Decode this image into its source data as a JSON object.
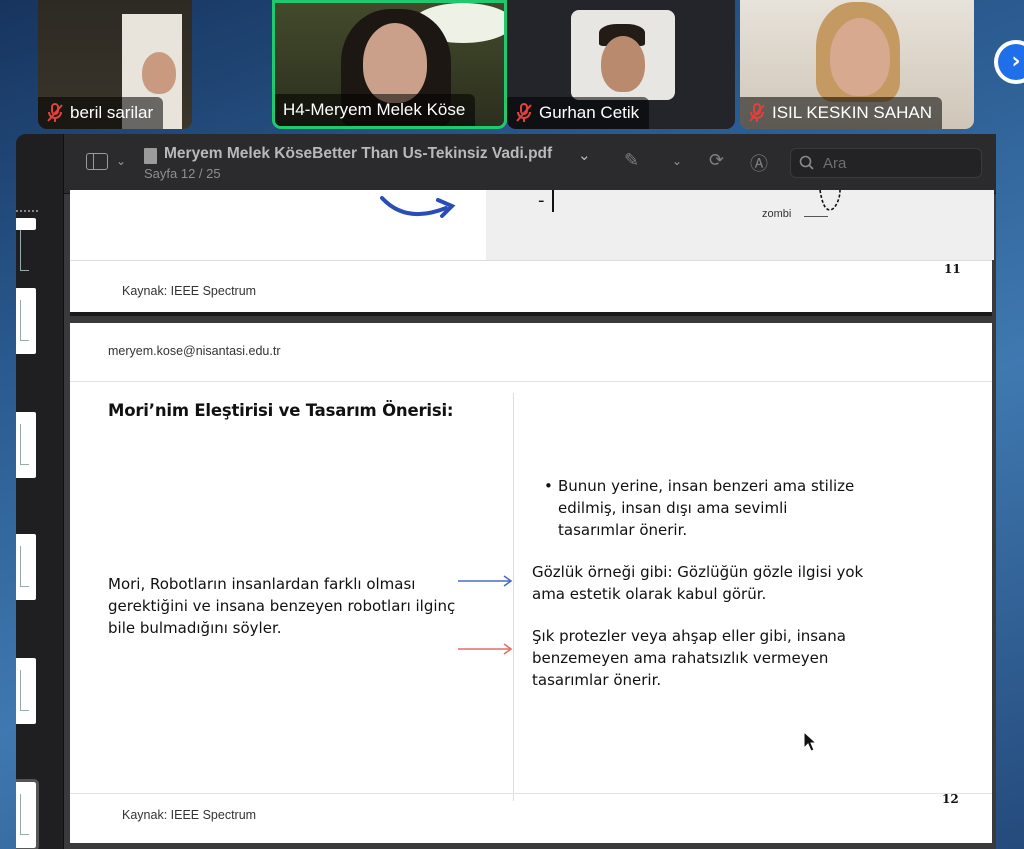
{
  "participants": [
    {
      "name": "beril sarilar",
      "muted": true
    },
    {
      "name": "H4-Meryem Melek Köse",
      "muted": false,
      "active": true
    },
    {
      "name": "Gurhan Cetik",
      "muted": true
    },
    {
      "name": "ISIL KESKIN SAHAN",
      "muted": true
    }
  ],
  "pdf": {
    "title": "Meryem Melek KöseBetter Than Us-Tekinsiz Vadi.pdf",
    "page_indicator": "Sayfa 12 / 25",
    "search_placeholder": "Ara"
  },
  "slide11": {
    "source": "Kaynak: IEEE Spectrum",
    "page_number": "11",
    "graph_label": "zombi",
    "minus_label": "-"
  },
  "slide12": {
    "email": "meryem.kose@nisantasi.edu.tr",
    "heading": "Mori’nim Eleştirisi ve Tasarım Önerisi:",
    "left_text": "Mori, Robotların insanlardan farklı olması gerektiğini ve insana benzeyen robotları ilginç bile bulmadığını söyler.",
    "bullet": "Bunun yerine, insan benzeri ama stilize edilmiş, insan dışı ama sevimli tasarımlar önerir.",
    "para2": "Gözlük örneği gibi: Gözlüğün gözle ilgisi yok ama estetik olarak kabul görür.",
    "para3": "Şık protezler veya ahşap eller gibi, insana benzemeyen ama rahatsızlık vermeyen tasarımlar önerir.",
    "source": "Kaynak: IEEE Spectrum",
    "page_number": "12",
    "arrow_colors": [
      "#4a6cc2",
      "#e07068"
    ]
  },
  "colors": {
    "active_speaker": "#20c96e",
    "muted_icon": "#e0413b",
    "next_button": "#1f6fea"
  }
}
